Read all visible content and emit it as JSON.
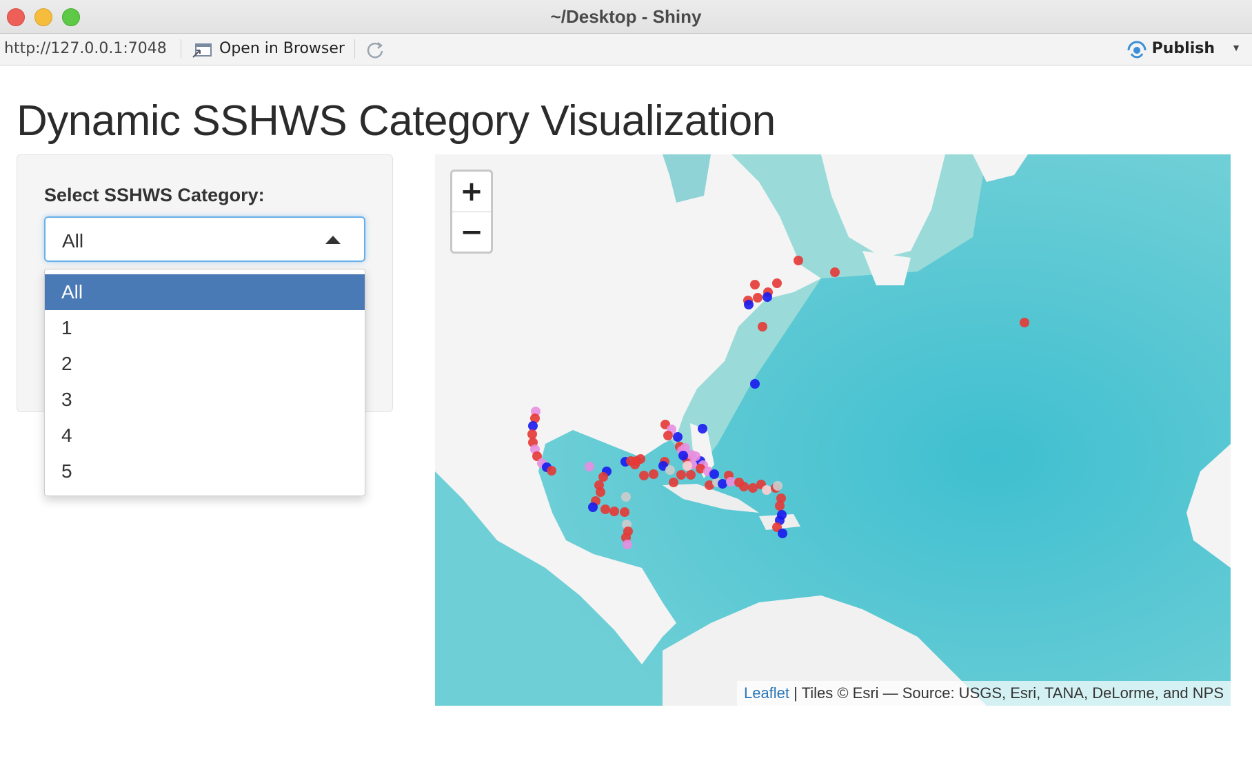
{
  "window": {
    "title": "~/Desktop - Shiny"
  },
  "toolbar": {
    "url": "http://127.0.0.1:7048",
    "open_label": "Open in Browser",
    "publish_label": "Publish"
  },
  "page": {
    "title": "Dynamic SSHWS Category Visualization"
  },
  "sidebar": {
    "select_label": "Select SSHWS Category:",
    "selected": "All",
    "options": [
      "All",
      "1",
      "2",
      "3",
      "4",
      "5"
    ]
  },
  "map": {
    "zoom_in": "+",
    "zoom_out": "−",
    "attribution_link": "Leaflet",
    "attribution_text": " | Tiles © Esri — Source: USGS, Esri, TANA, DeLorme, and NPS",
    "marker_colors": [
      "#e53935",
      "#1a1aee",
      "#e88ee0",
      "#cccccc",
      "#ffd0d0"
    ]
  }
}
